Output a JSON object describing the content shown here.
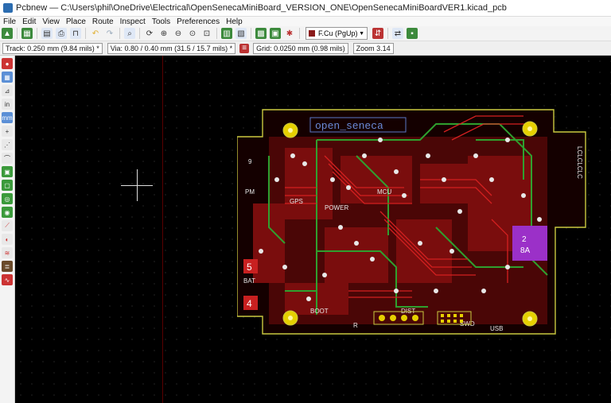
{
  "window": {
    "title": "Pcbnew — C:\\Users\\phil\\OneDrive\\Electrical\\OpenSenecaMiniBoard_VERSION_ONE\\OpenSenecaMiniBoardVER1.kicad_pcb"
  },
  "menu": [
    "File",
    "Edit",
    "View",
    "Place",
    "Route",
    "Inspect",
    "Tools",
    "Preferences",
    "Help"
  ],
  "toolbar": {
    "layer": "F.Cu (PgUp)"
  },
  "options": {
    "track": "Track: 0.250 mm (9.84 mils) *",
    "via": "Via: 0.80 / 0.40 mm (31.5 / 15.7 mils) *",
    "grid": "Grid: 0.0250 mm (0.98 mils)",
    "zoom": "Zoom 3.14"
  },
  "board_labels": {
    "silk_title": "open_seneca",
    "power": "POWER",
    "gps": "GPS",
    "boot": "BOOT",
    "dist": "DIST",
    "swd": "SWD",
    "usb": "USB",
    "bat": "BAT",
    "pm": "PM",
    "mcu": "MCU",
    "num5": "5",
    "num4": "4",
    "num2": "2",
    "num8a": "8A",
    "rside": "LCLCLCLC",
    "r": "R",
    "nine": "9"
  }
}
